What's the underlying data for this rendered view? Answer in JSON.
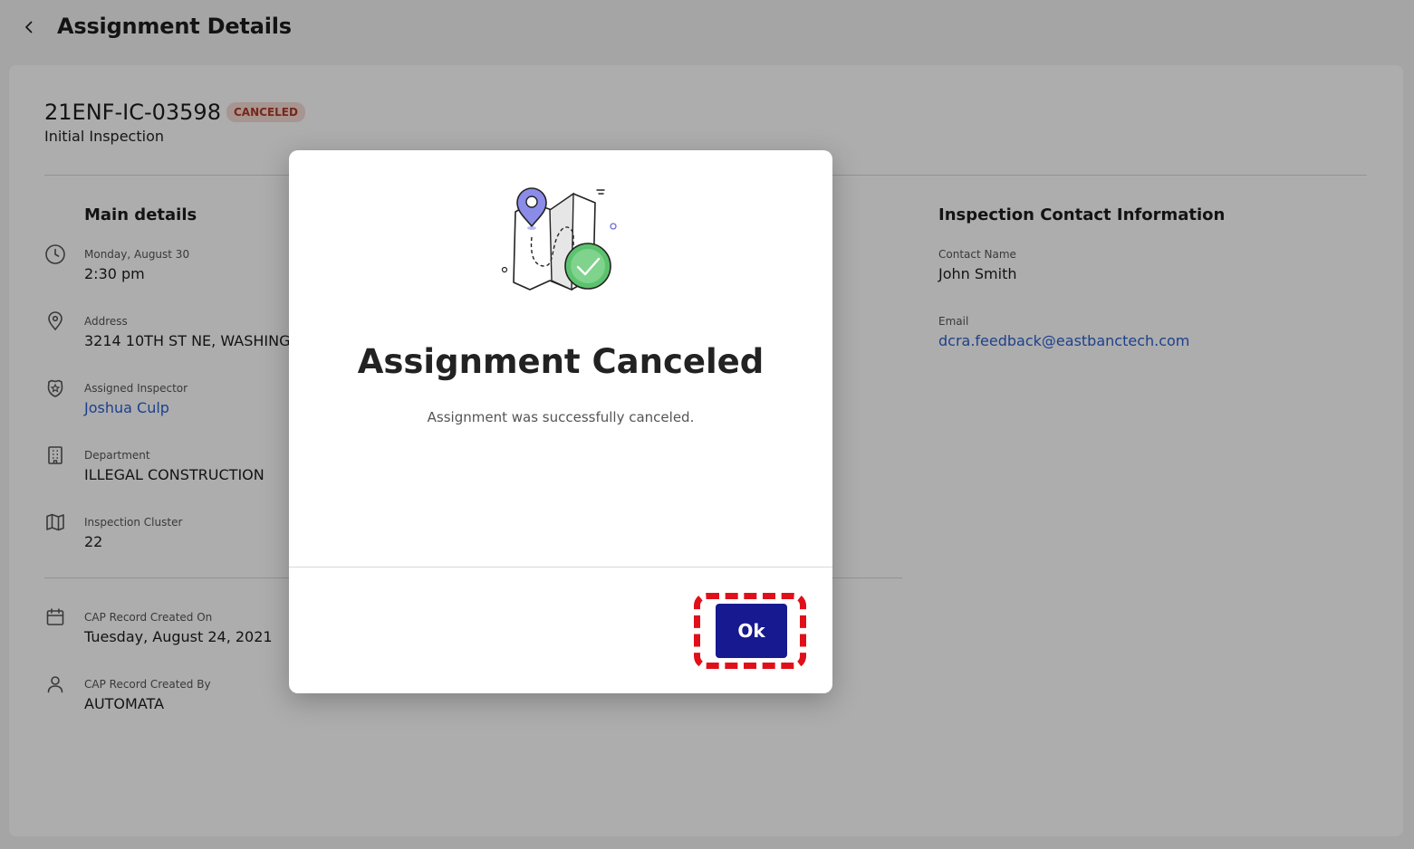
{
  "header": {
    "title": "Assignment Details"
  },
  "record": {
    "id": "21ENF-IC-03598",
    "status": "CANCELED",
    "type": "Initial Inspection"
  },
  "main_details": {
    "title": "Main details",
    "date_label": "Monday, August 30",
    "time_value": "2:30 pm",
    "address_label": "Address",
    "address_value": "3214 10TH ST NE, WASHINGTON",
    "inspector_label": "Assigned Inspector",
    "inspector_value": "Joshua Culp",
    "department_label": "Department",
    "department_value": "ILLEGAL CONSTRUCTION",
    "cluster_label": "Inspection Cluster",
    "cluster_value": "22",
    "created_on_label": "CAP Record Created On",
    "created_on_value": "Tuesday, August 24, 2021",
    "created_by_label": "CAP Record Created By",
    "created_by_value": "AUTOMATA"
  },
  "contact": {
    "title": "Inspection Contact Information",
    "name_label": "Contact Name",
    "name_value": "John Smith",
    "email_label": "Email",
    "email_value": "dcra.feedback@eastbanctech.com"
  },
  "modal": {
    "title": "Assignment Canceled",
    "message": "Assignment was successfully canceled.",
    "ok_label": "Ok"
  },
  "colors": {
    "primary_button": "#16198f",
    "link": "#2b5fd0",
    "badge_bg": "#f7dcd6",
    "badge_text": "#b23a22",
    "highlight": "#e0101a",
    "success": "#5cc26e",
    "pin": "#8a8ce8"
  }
}
